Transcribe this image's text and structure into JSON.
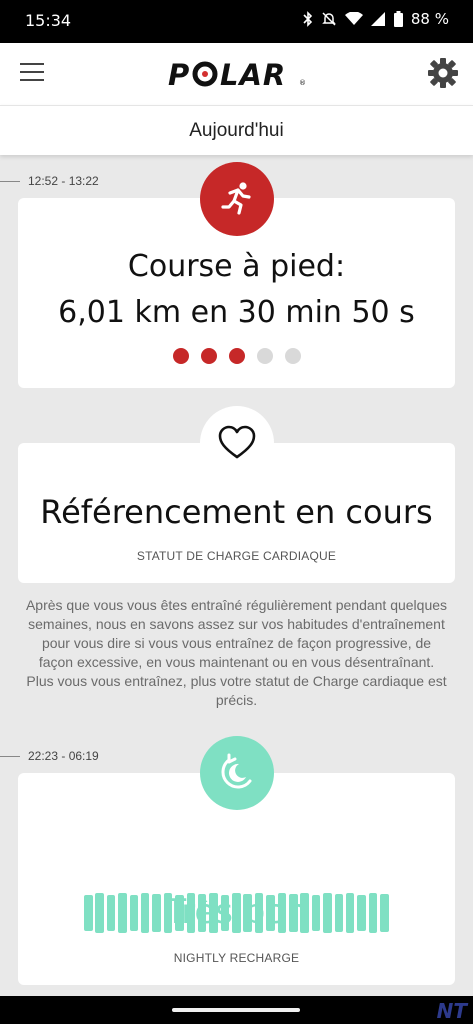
{
  "status_bar": {
    "time": "15:34",
    "battery_percent": "88 %",
    "icons": [
      "bluetooth-icon",
      "bell-off-icon",
      "wifi-icon",
      "cellular-icon",
      "battery-icon"
    ]
  },
  "app_bar": {
    "logo_text": "POLAR",
    "menu_icon": "menu-icon",
    "settings_icon": "gear-icon"
  },
  "day_header": "Aujourd'hui",
  "activity": {
    "time_range": "12:52 - 13:22",
    "icon": "running-icon",
    "title_line1": "Course à pied:",
    "title_line2": "6,01 km en 30 min 50 s",
    "rating_filled": 3,
    "rating_total": 5,
    "accent_color": "#c62828"
  },
  "cardio_load": {
    "icon": "heart-icon",
    "title": "Référencement en cours",
    "label": "STATUT DE CHARGE CARDIAQUE",
    "description": "Après que vous vous êtes entraîné régulièrement pendant quelques semaines, nous en savons assez sur vos habitudes d'entraînement pour vous dire si vous vous entraînez de façon progressive, de façon excessive, en vous maintenant ou en vous désentraînant. Plus vous vous entraînez, plus votre statut de Charge cardiaque est précis."
  },
  "nightly_recharge": {
    "time_range": "22:23 - 06:19",
    "icon": "recharge-moon-icon",
    "status": "Très bon",
    "label": "NIGHTLY RECHARGE",
    "accent_color": "#7fe0c3",
    "bar_levels": [
      0.9,
      1.0,
      0.9,
      1.0,
      0.9,
      1.0,
      0.95,
      1.0,
      0.9,
      1.0,
      0.95,
      1.0,
      0.9,
      1.0,
      0.95,
      1.0,
      0.9,
      1.0,
      0.95,
      1.0,
      0.9,
      1.0,
      0.95,
      1.0,
      0.9,
      1.0,
      0.95
    ]
  },
  "watermark": "NT"
}
